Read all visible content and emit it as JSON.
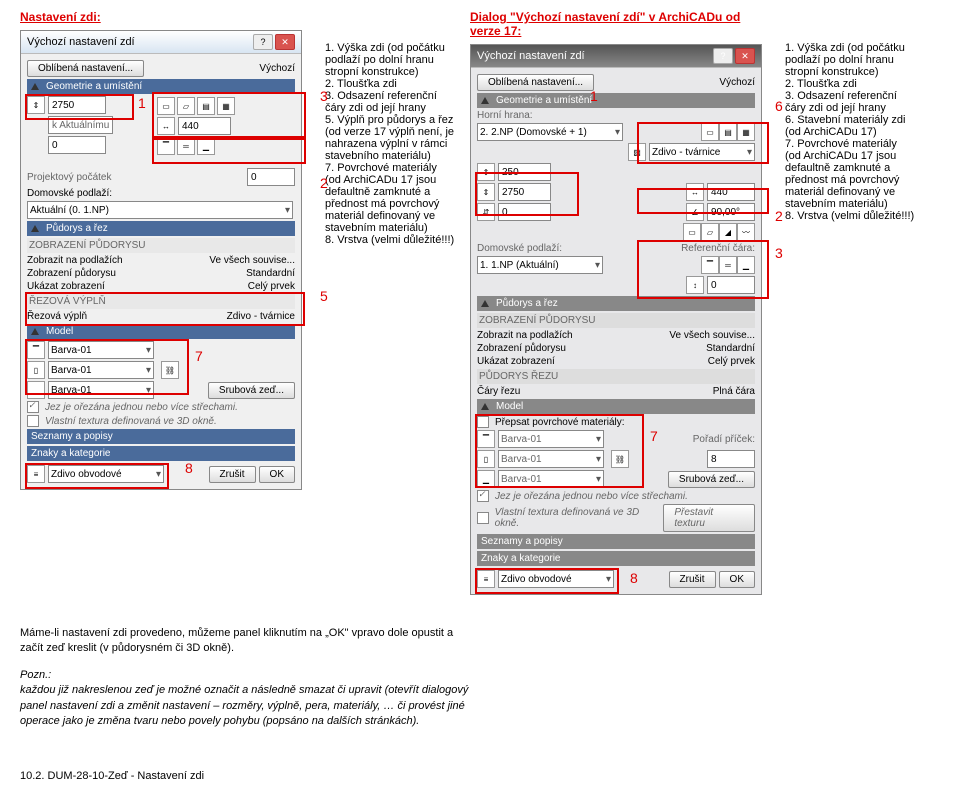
{
  "titles": {
    "left": "Nastavení zdi:",
    "right": "Dialog \"Výchozí nastavení zdí\" v ArchiCADu od verze 17:"
  },
  "dlgL": {
    "title": "Výchozí nastavení zdí",
    "fav": "Oblíbená nastavení...",
    "default": "Výchozí",
    "sec_geom": "Geometrie a umístění",
    "h": "2750",
    "w": "440",
    "off": "0",
    "proj": "Projektový počátek",
    "proj_v": "0",
    "floor": "Domovské podlaží:",
    "floor_v": "Aktuální (0. 1.NP)",
    "sec_floor": "Půdorys a řez",
    "floor_grp": "ZOBRAZENÍ PŮDORYSU",
    "r1a": "Zobrazit na podlažích",
    "r1b": "Ve všech souvise...",
    "r2a": "Zobrazení půdorysu",
    "r2b": "Standardní",
    "r3a": "Ukázat zobrazení",
    "r3b": "Celý prvek",
    "cut_grp": "ŘEZOVÁ VÝPLŇ",
    "cut_a": "Řezová výplň",
    "cut_b": "Zdivo - tvárnice",
    "sec_model": "Model",
    "b1": "Barva-01",
    "b2": "Barva-01",
    "b3": "Barva-01",
    "srub": "Srubová zeď...",
    "trim": "Jez je ořezána jednou nebo více střechami.",
    "tex": "Vlastní textura definovaná ve 3D okně.",
    "lists": "Seznamy a popisy",
    "tags": "Znaky a kategorie",
    "mat": "Zdivo obvodové",
    "cancel": "Zrušit",
    "ok": "OK"
  },
  "dlgR": {
    "title": "Výchozí nastavení zdí",
    "fav": "Oblíbená nastavení...",
    "default": "Výchozí",
    "sec_geom": "Geometrie a umístění",
    "ref": "Horní hrana:",
    "ref_v": "2. 2.NP (Domovské + 1)",
    "mat": "Zdivo - tvárnice",
    "h": "250",
    "h2": "2750",
    "w": "440",
    "ang": "90,00°",
    "off": "0",
    "floor": "Domovské podlaží:",
    "floor_v": "1. 1.NP (Aktuální)",
    "refline": "Referenční čára:",
    "ref_off": "0",
    "sec_floor": "Půdorys a řez",
    "floor_grp": "ZOBRAZENÍ PŮDORYSU",
    "r1a": "Zobrazit na podlažích",
    "r1b": "Ve všech souvise...",
    "r2a": "Zobrazení půdorysu",
    "r2b": "Standardní",
    "r3a": "Ukázat zobrazení",
    "r3b": "Celý prvek",
    "cut_grp": "PŮDORYS ŘEZU",
    "cut_a": "Čáry řezu",
    "cut_b": "Plná čára",
    "sec_model": "Model",
    "over": "Přepsat povrchové materiály:",
    "b1": "Barva-01",
    "b2": "Barva-01",
    "b3": "Barva-01",
    "prio": "Pořadí příček:",
    "prio_v": "8",
    "srub": "Srubová zeď...",
    "trim": "Jez je ořezána jednou nebo více střechami.",
    "tex": "Vlastní textura definovaná ve 3D okně.",
    "retex": "Přestavit texturu",
    "lists": "Seznamy a popisy",
    "tags": "Znaky a kategorie",
    "matb": "Zdivo obvodové",
    "cancel": "Zrušit",
    "ok": "OK"
  },
  "notesL": "1. Výška zdi (od počátku podlaží po dolní hranu stropní konstrukce)\n2. Tloušťka zdi\n3. Odsazení referenční čáry zdi od její hrany\n5. Výplň pro půdorys a řez (od verze 17 výplň není, je nahrazena výplní v rámci stavebního materiálu)\n7. Povrchové materiály (od ArchiCADu 17 jsou defaultně zamknuté a přednost má povrchový materiál definovaný ve stavebním materiálu)\n8. Vrstva (velmi důležité!!!)",
  "notesR": "1. Výška zdi (od počátku podlaží po dolní hranu stropní konstrukce)\n2. Tloušťka zdi\n3. Odsazení referenční čáry zdi od její hrany\n6. Stavební materiály zdi (od ArchiCADu 17)\n7. Povrchové materiály (od ArchiCADu 17 jsou defaultně zamknuté a přednost má povrchový materiál definovaný ve stavebním materiálu)\n8. Vrstva (velmi důležité!!!)",
  "bottom": {
    "p1": "Máme-li nastavení zdi provedeno, můžeme panel kliknutím na „OK\" vpravo dole opustit a začít zeď kreslit (v půdorysném či 3D okně).",
    "p2": "Pozn.:\nkaždou již nakreslenou zeď je možné označit a následně smazat či upravit (otevřít dialogový panel nastavení zdi a změnit nastavení – rozměry, výplně, pera, materiály, … či provést jiné operace jako je změna tvaru nebo povely pohybu (popsáno na dalších stránkách).",
    "footer": "10.2. DUM-28-10-Zeď - Nastavení zdi"
  },
  "nums": {
    "n1": "1",
    "n2": "2",
    "n3": "3",
    "n5": "5",
    "n6": "6",
    "n7": "7",
    "n8": "8"
  }
}
